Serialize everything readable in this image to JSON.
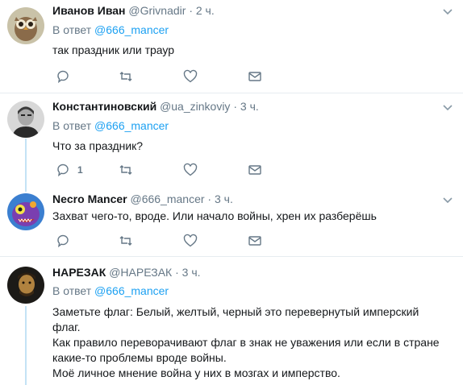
{
  "tweets": [
    {
      "name": "Иванов Иван",
      "handle": "@Grivnadir",
      "time": "2 ч.",
      "reply_prefix": "В ответ",
      "reply_mention": "@666_mancer",
      "text": [
        "так праздник или траур"
      ],
      "reply_count": ""
    },
    {
      "name": "Константиновский",
      "handle": "@ua_zinkoviy",
      "time": "3 ч.",
      "reply_prefix": "В ответ",
      "reply_mention": "@666_mancer",
      "text": [
        "Что за праздник?"
      ],
      "reply_count": "1"
    },
    {
      "name": "Necro Mancer",
      "handle": "@666_mancer",
      "time": "3 ч.",
      "text": [
        "Захват чего-то, вроде. Или начало войны, хрен их разберёшь"
      ],
      "reply_count": ""
    },
    {
      "name": "НАРЕЗАК",
      "handle": "@НАРЕЗАК",
      "time": "3 ч.",
      "reply_prefix": "В ответ",
      "reply_mention": "@666_mancer",
      "text": [
        "Заметьте флаг: Белый, желтый, черный это перевернутый имперский",
        "флаг.",
        "Как правило переворачивают флаг в знак не уважения или если в стране",
        "какие-то проблемы вроде войны.",
        "Моё личное мнение война у них в мозгах и имперство."
      ],
      "reply_count": ""
    }
  ],
  "separator": "·",
  "colors": {
    "link": "#1da1f2",
    "muted": "#657786",
    "thread_line": "#c4e2f5",
    "divider": "#e6ecf0"
  }
}
